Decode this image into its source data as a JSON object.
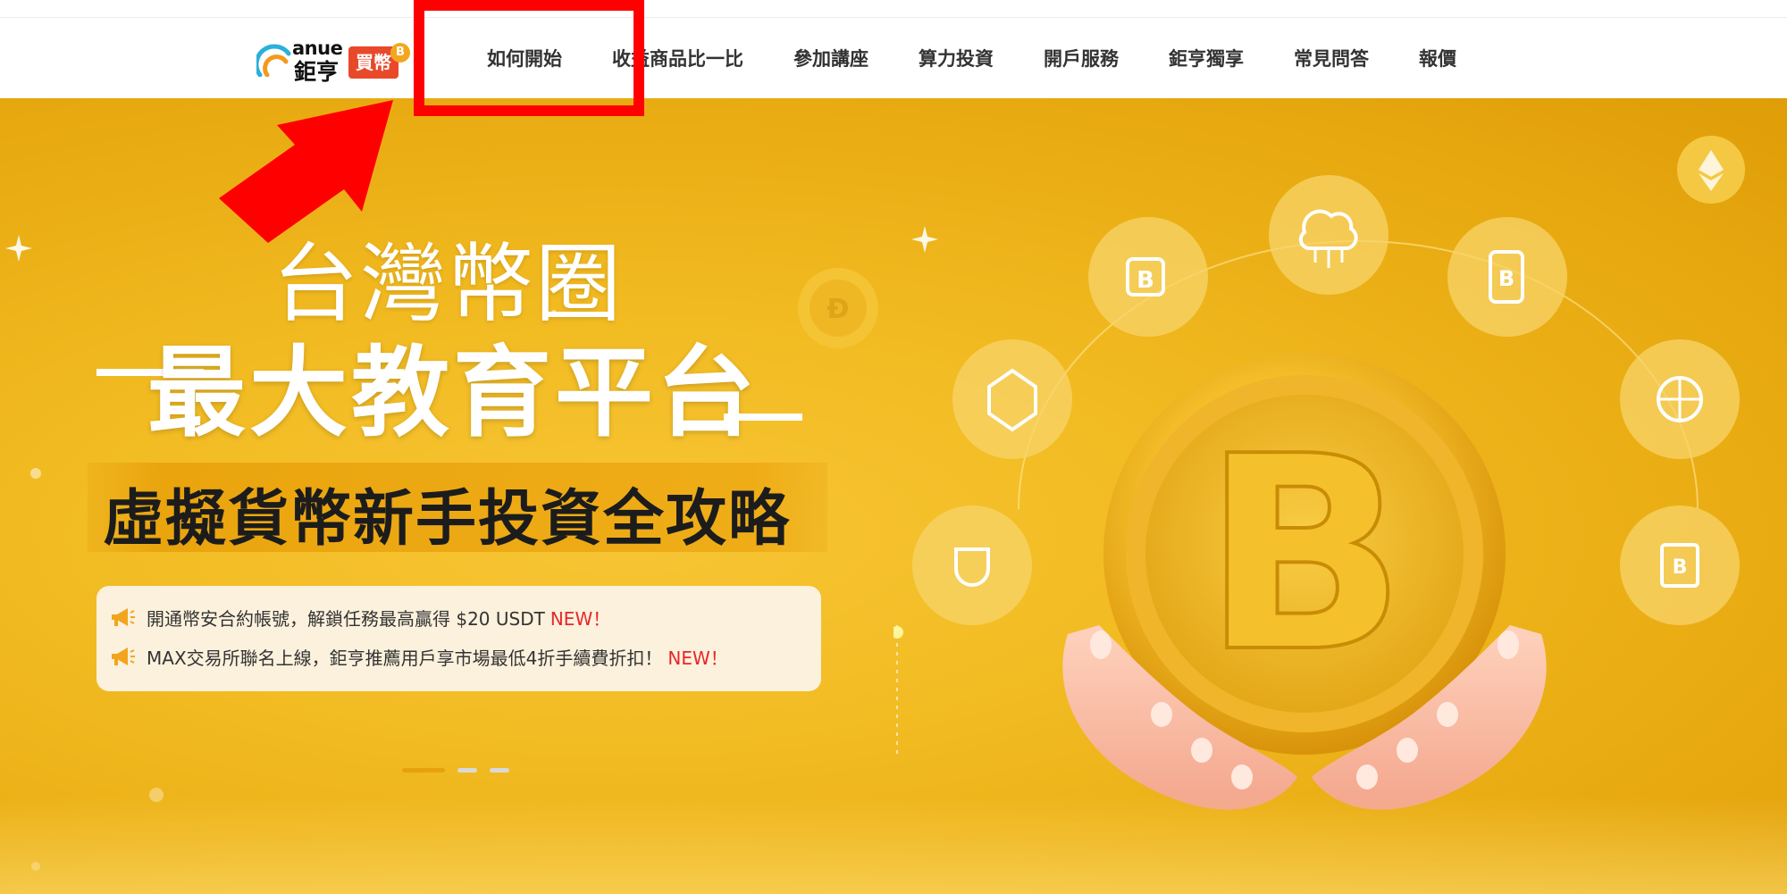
{
  "logo": {
    "brand_en": "anue",
    "brand_cn": "鉅亨",
    "badge": "買幣",
    "coin_glyph": "B"
  },
  "nav": {
    "items": [
      {
        "label": "如何開始"
      },
      {
        "label": "收益商品比一比"
      },
      {
        "label": "參加講座"
      },
      {
        "label": "算力投資"
      },
      {
        "label": "開戶服務"
      },
      {
        "label": "鉅亨獨享"
      },
      {
        "label": "常見問答"
      },
      {
        "label": "報價"
      }
    ]
  },
  "hero": {
    "title_line1": "台灣幣圈",
    "title_line2": "最大教育平台",
    "subtitle": "虛擬貨幣新手投資全攻略",
    "notices": [
      {
        "text": "開通幣安合約帳號，解鎖任務最高贏得 $20 USDT",
        "badge": "NEW！",
        "icon": "megaphone-icon"
      },
      {
        "text": "MAX交易所聯名上線，鉅亨推薦用戶享市場最低4折手續費折扣！",
        "badge": "NEW！",
        "icon": "megaphone-icon"
      }
    ],
    "coin_symbol": "B",
    "carousel": {
      "count": 3,
      "active": 0
    }
  },
  "annotations": {
    "highlight_color": "#ff0000"
  },
  "colors": {
    "accent": "#f2bb22",
    "badge_red": "#e8492b",
    "new_red": "#e8262b"
  }
}
